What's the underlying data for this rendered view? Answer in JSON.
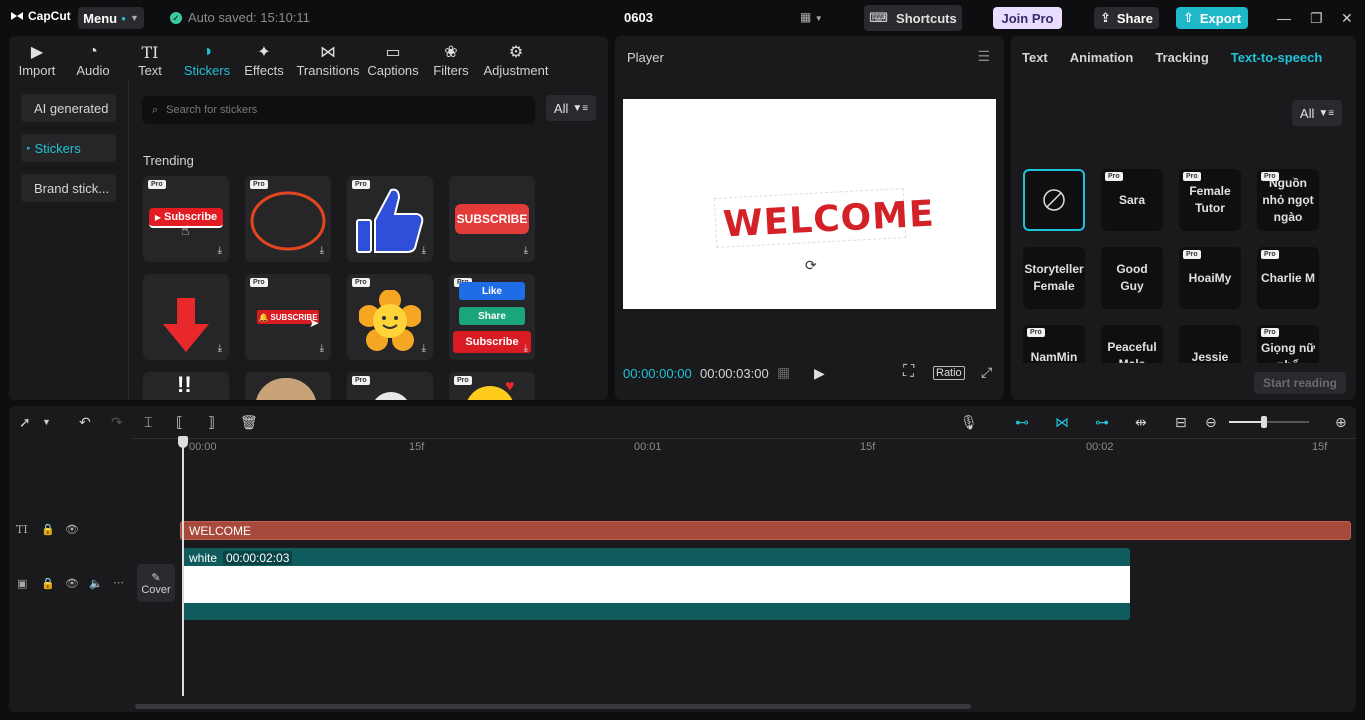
{
  "app": {
    "logo": "CapCut",
    "menu_label": "Menu",
    "autosave": "Auto saved: 15:10:11",
    "project_name": "0603",
    "shortcuts_label": "Shortcuts",
    "join_pro_label": "Join Pro",
    "share_label": "Share",
    "export_label": "Export"
  },
  "toolbar": {
    "tabs": [
      {
        "label": "Import",
        "icon": "import-icon"
      },
      {
        "label": "Audio",
        "icon": "audio-icon"
      },
      {
        "label": "Text",
        "icon": "text-icon"
      },
      {
        "label": "Stickers",
        "icon": "stickers-icon",
        "active": true
      },
      {
        "label": "Effects",
        "icon": "effects-icon"
      },
      {
        "label": "Transitions",
        "icon": "transitions-icon"
      },
      {
        "label": "Captions",
        "icon": "captions-icon"
      },
      {
        "label": "Filters",
        "icon": "filters-icon"
      },
      {
        "label": "Adjustment",
        "icon": "adjustment-icon"
      }
    ]
  },
  "stickers_panel": {
    "side_items": [
      "AI generated",
      "Stickers",
      "Brand stick..."
    ],
    "search_placeholder": "Search for stickers",
    "filter_label": "All",
    "section_title": "Trending",
    "sticker_labels": {
      "subscribe": "Subscribe",
      "subscribe_caps": "SUBSCRIBE",
      "like": "Like",
      "share": "Share",
      "subscribe_small": "SUBSCRIBE"
    },
    "pro_label": "Pro"
  },
  "player": {
    "title": "Player",
    "preview_text": "WELCOME",
    "current_time": "00:00:00:00",
    "total_time": "00:00:03:00",
    "ratio_label": "Ratio"
  },
  "properties": {
    "tabs": [
      "Text",
      "Animation",
      "Tracking",
      "Text-to-speech"
    ],
    "active_tab": "Text-to-speech",
    "filter_label": "All",
    "voices": [
      {
        "name": "",
        "pro": false,
        "none": true
      },
      {
        "name": "Sara",
        "pro": true
      },
      {
        "name": "Female Tutor",
        "pro": true
      },
      {
        "name": "Nguồn nhỏ ngọt ngào",
        "pro": true
      },
      {
        "name": "Storyteller Female",
        "pro": false
      },
      {
        "name": "Good Guy",
        "pro": false
      },
      {
        "name": "HoaiMy",
        "pro": true
      },
      {
        "name": "Charlie M",
        "pro": true
      },
      {
        "name": "NamMin",
        "pro": true
      },
      {
        "name": "Peaceful Male",
        "pro": false
      },
      {
        "name": "Jessie",
        "pro": false
      },
      {
        "name": "Giọng nữ phổ thông",
        "pro": true
      }
    ],
    "start_reading_label": "Start reading"
  },
  "timeline": {
    "ruler": [
      "00:00",
      "15f",
      "00:01",
      "15f",
      "00:02",
      "15f"
    ],
    "text_clip_label": "WELCOME",
    "video_clip_name": "white",
    "video_clip_duration": "00:00:02:03",
    "cover_label": "Cover"
  },
  "colors": {
    "accent": "#1fc2d6",
    "text_clip": "#a84a3b",
    "video_clip": "#0f5b5e",
    "welcome_red": "#d42027"
  }
}
